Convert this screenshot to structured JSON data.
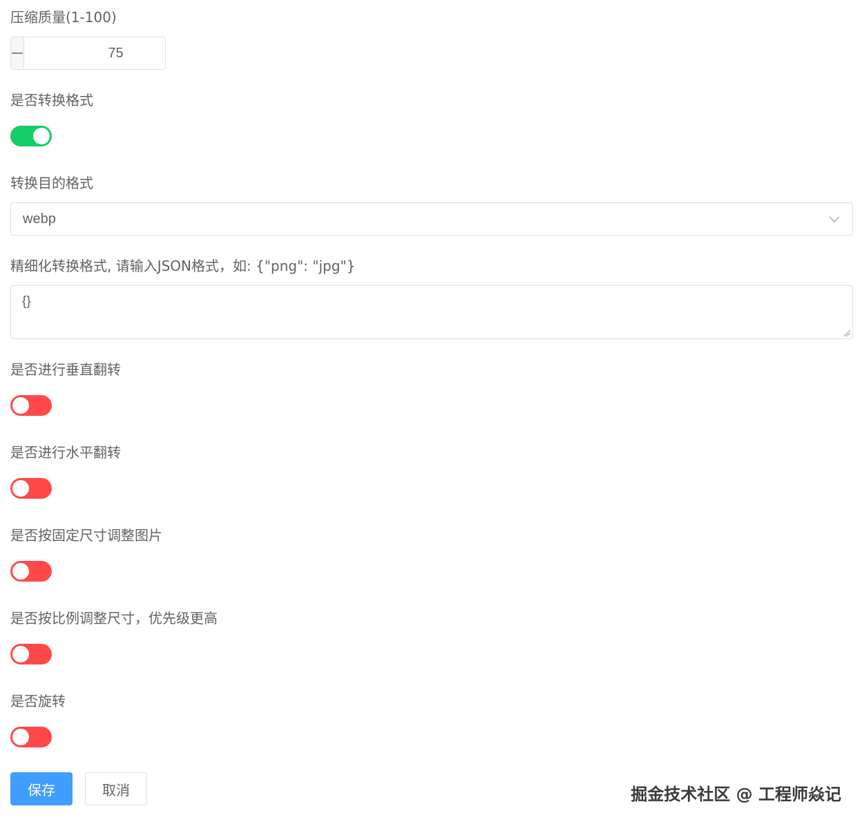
{
  "colors": {
    "switch_on": "#13ce66",
    "switch_off": "#ff4949",
    "primary": "#409eff"
  },
  "quality": {
    "label": "压缩质量(1-100)",
    "value": "75",
    "minus_icon": "minus-icon",
    "plus_icon": "plus-icon"
  },
  "convert": {
    "label": "是否转换格式",
    "enabled": true
  },
  "target_format": {
    "label": "转换目的格式",
    "value": "webp",
    "icon": "chevron-down-icon"
  },
  "fine_format": {
    "label": "精细化转换格式, 请输入JSON格式，如: {\"png\": \"jpg\"}",
    "value": "{}"
  },
  "vertical_flip": {
    "label": "是否进行垂直翻转",
    "enabled": false
  },
  "horizontal_flip": {
    "label": "是否进行水平翻转",
    "enabled": false
  },
  "fixed_resize": {
    "label": "是否按固定尺寸调整图片",
    "enabled": false
  },
  "ratio_resize": {
    "label": "是否按比例调整尺寸，优先级更高",
    "enabled": false
  },
  "rotate": {
    "label": "是否旋转",
    "enabled": false
  },
  "actions": {
    "save_label": "保存",
    "cancel_label": "取消"
  },
  "watermark": "掘金技术社区 @ 工程师焱记"
}
